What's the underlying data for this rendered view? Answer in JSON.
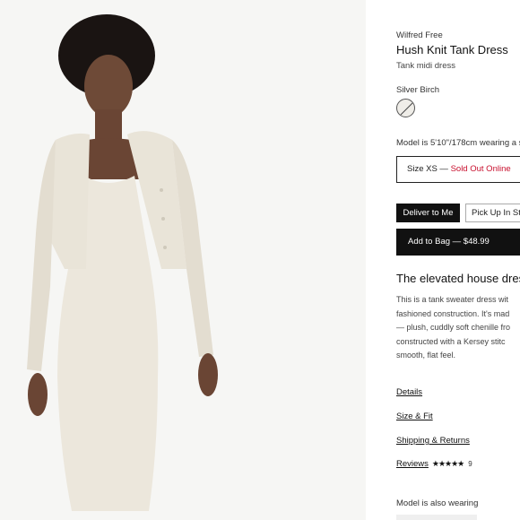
{
  "product": {
    "brand": "Wilfred Free",
    "name": "Hush Knit Tank Dress",
    "type": "Tank midi dress",
    "color_label": "Silver Birch",
    "color_swatch": "#efede8",
    "model_note": "Model is 5'10\"/178cm wearing a s",
    "size_prefix": "Size XS — ",
    "size_status": "Sold Out Online",
    "size_status_color": "#c8102e"
  },
  "fulfillment": {
    "deliver_label": "Deliver to Me",
    "pickup_label": "Pick Up In St"
  },
  "cart": {
    "add_label": "Add to Bag — $48.99"
  },
  "description": {
    "headline": "The elevated house dres",
    "lines": [
      "This is a tank sweater dress wit",
      "fashioned construction. It's mad",
      "— plush, cuddly soft chenille fro",
      "constructed with a Kersey stitc",
      "smooth, flat feel."
    ]
  },
  "links": {
    "details": "Details",
    "size_fit": "Size & Fit",
    "shipping": "Shipping & Returns",
    "reviews": "Reviews",
    "stars": "★★★★★",
    "review_count": "9"
  },
  "also_wearing": {
    "label": "Model is also wearing"
  }
}
